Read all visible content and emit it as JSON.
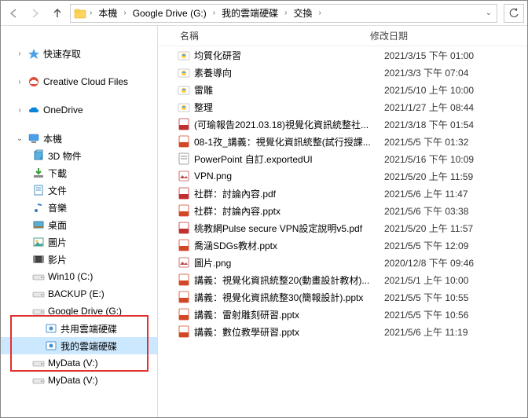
{
  "breadcrumb": {
    "items": [
      "本機",
      "Google Drive (G:)",
      "我的雲端硬碟",
      "交換"
    ]
  },
  "sidebar": {
    "quick_access": "快速存取",
    "creative_cloud": "Creative Cloud Files",
    "onedrive": "OneDrive",
    "this_pc": "本機",
    "items": [
      {
        "label": "3D 物件"
      },
      {
        "label": "下載"
      },
      {
        "label": "文件"
      },
      {
        "label": "音樂"
      },
      {
        "label": "桌面"
      },
      {
        "label": "圖片"
      },
      {
        "label": "影片"
      },
      {
        "label": "Win10 (C:)"
      },
      {
        "label": "BACKUP (E:)"
      },
      {
        "label": "Google Drive (G:)"
      },
      {
        "label": "共用雲端硬碟"
      },
      {
        "label": "我的雲端硬碟"
      },
      {
        "label": "MyData (V:)"
      },
      {
        "label": "MyData (V:)"
      }
    ]
  },
  "columns": {
    "name": "名稱",
    "date": "修改日期"
  },
  "files": [
    {
      "icon": "folder-g",
      "name": "均質化研習",
      "date": "2021/3/15 下午 01:00"
    },
    {
      "icon": "folder-g",
      "name": "素養導向",
      "date": "2021/3/3 下午 07:04"
    },
    {
      "icon": "folder-g",
      "name": "雷雕",
      "date": "2021/5/10 上午 10:00"
    },
    {
      "icon": "folder-g",
      "name": "整理",
      "date": "2021/1/27 上午 08:44"
    },
    {
      "icon": "pdf",
      "name": "(可瑜報告2021.03.18)視覺化資訊統整社...",
      "date": "2021/3/18 下午 01:54"
    },
    {
      "icon": "pptx",
      "name": "08-1孜_講義：視覺化資訊統整(試行授課...",
      "date": "2021/5/5 下午 01:32"
    },
    {
      "icon": "generic",
      "name": "PowerPoint 自訂.exportedUI",
      "date": "2021/5/16 下午 10:09"
    },
    {
      "icon": "png",
      "name": "VPN.png",
      "date": "2021/5/20 上午 11:59"
    },
    {
      "icon": "pdf",
      "name": "社群：討論內容.pdf",
      "date": "2021/5/6 上午 11:47"
    },
    {
      "icon": "pptx",
      "name": "社群：討論內容.pptx",
      "date": "2021/5/6 下午 03:38"
    },
    {
      "icon": "pdf",
      "name": "桃教網Pulse secure VPN設定說明v5.pdf",
      "date": "2021/5/20 上午 11:57"
    },
    {
      "icon": "pptx",
      "name": "喬涵SDGs教材.pptx",
      "date": "2021/5/5 下午 12:09"
    },
    {
      "icon": "png",
      "name": "圖片.png",
      "date": "2020/12/8 下午 09:46"
    },
    {
      "icon": "pptx",
      "name": "講義：視覺化資訊統整20(動畫設計教材)...",
      "date": "2021/5/1 上午 10:00"
    },
    {
      "icon": "pptx",
      "name": "講義：視覺化資訊統整30(簡報設計).pptx",
      "date": "2021/5/5 下午 10:55"
    },
    {
      "icon": "pptx",
      "name": "講義：雷射雕刻研習.pptx",
      "date": "2021/5/5 下午 10:56"
    },
    {
      "icon": "pptx",
      "name": "講義：數位教學研習.pptx",
      "date": "2021/5/6 上午 11:19"
    }
  ]
}
